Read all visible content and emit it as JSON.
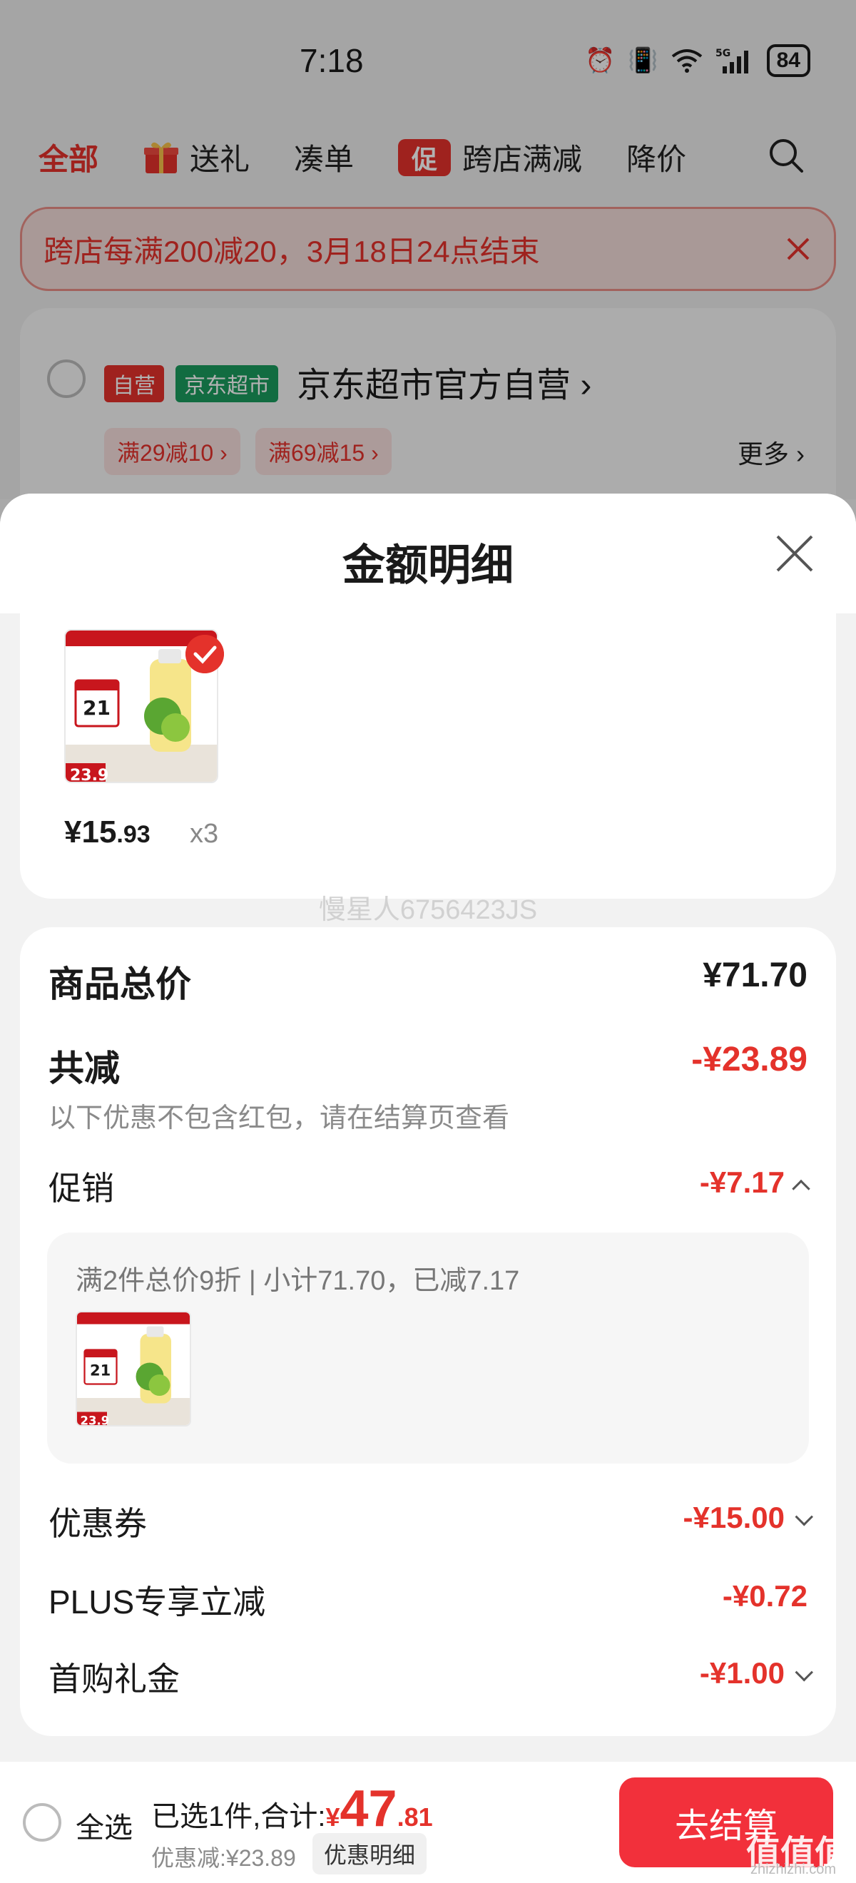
{
  "status_bar": {
    "time": "7:18",
    "battery": "84"
  },
  "top_tabs": [
    "全部",
    "送礼",
    "凑单",
    "跨店满减",
    "降价"
  ],
  "promo_tag": "促",
  "banner": {
    "text": "跨店每满200减20，3月18日24点结束"
  },
  "shop": {
    "tag_self": "自营",
    "tag_jd": "京东超市",
    "name": "京东超市官方自营 ›",
    "coupons": [
      "满29减10 ›",
      "满69减15 ›"
    ],
    "more": "更多 ›"
  },
  "sheet": {
    "title": "金额明细",
    "item": {
      "price_main": "¥15",
      "price_dec": ".93",
      "qty": "x3"
    },
    "watermark": "慢星人6756423JS",
    "summary": {
      "total_label": "商品总价",
      "total_value": "¥71.70",
      "discount_label": "共减",
      "discount_value": "-¥23.89",
      "discount_note": "以下优惠不包含红包，请在结算页查看",
      "promo_label": "促销",
      "promo_value": "-¥7.17",
      "promo_desc": "满2件总价9折 | 小计71.70，已减7.17",
      "coupon_label": "优惠券",
      "coupon_value": "-¥15.00",
      "plus_label": "PLUS专享立减",
      "plus_value": "-¥0.72",
      "gift_label": "首购礼金",
      "gift_value": "-¥1.00"
    }
  },
  "bottom_bar": {
    "select_all": "全选",
    "selected_text": "已选1件,合计:",
    "yen": "¥",
    "total_int": "47",
    "total_dec": ".81",
    "saved": "优惠减:¥23.89",
    "detail_button": "优惠明细",
    "checkout_button": "去结算",
    "site_mark": "值值值",
    "site_url": "zhizhizhi.com"
  },
  "colors": {
    "accent": "#e4322b",
    "jd_green": "#1a9b5e",
    "checkout": "#f2303b"
  },
  "icons": [
    "alarm-icon",
    "vibrate-icon",
    "wifi-icon",
    "signal-5g-icon",
    "battery-icon",
    "gift-icon",
    "search-icon",
    "close-icon",
    "check-icon",
    "chevron-down-icon",
    "chevron-up-icon"
  ]
}
